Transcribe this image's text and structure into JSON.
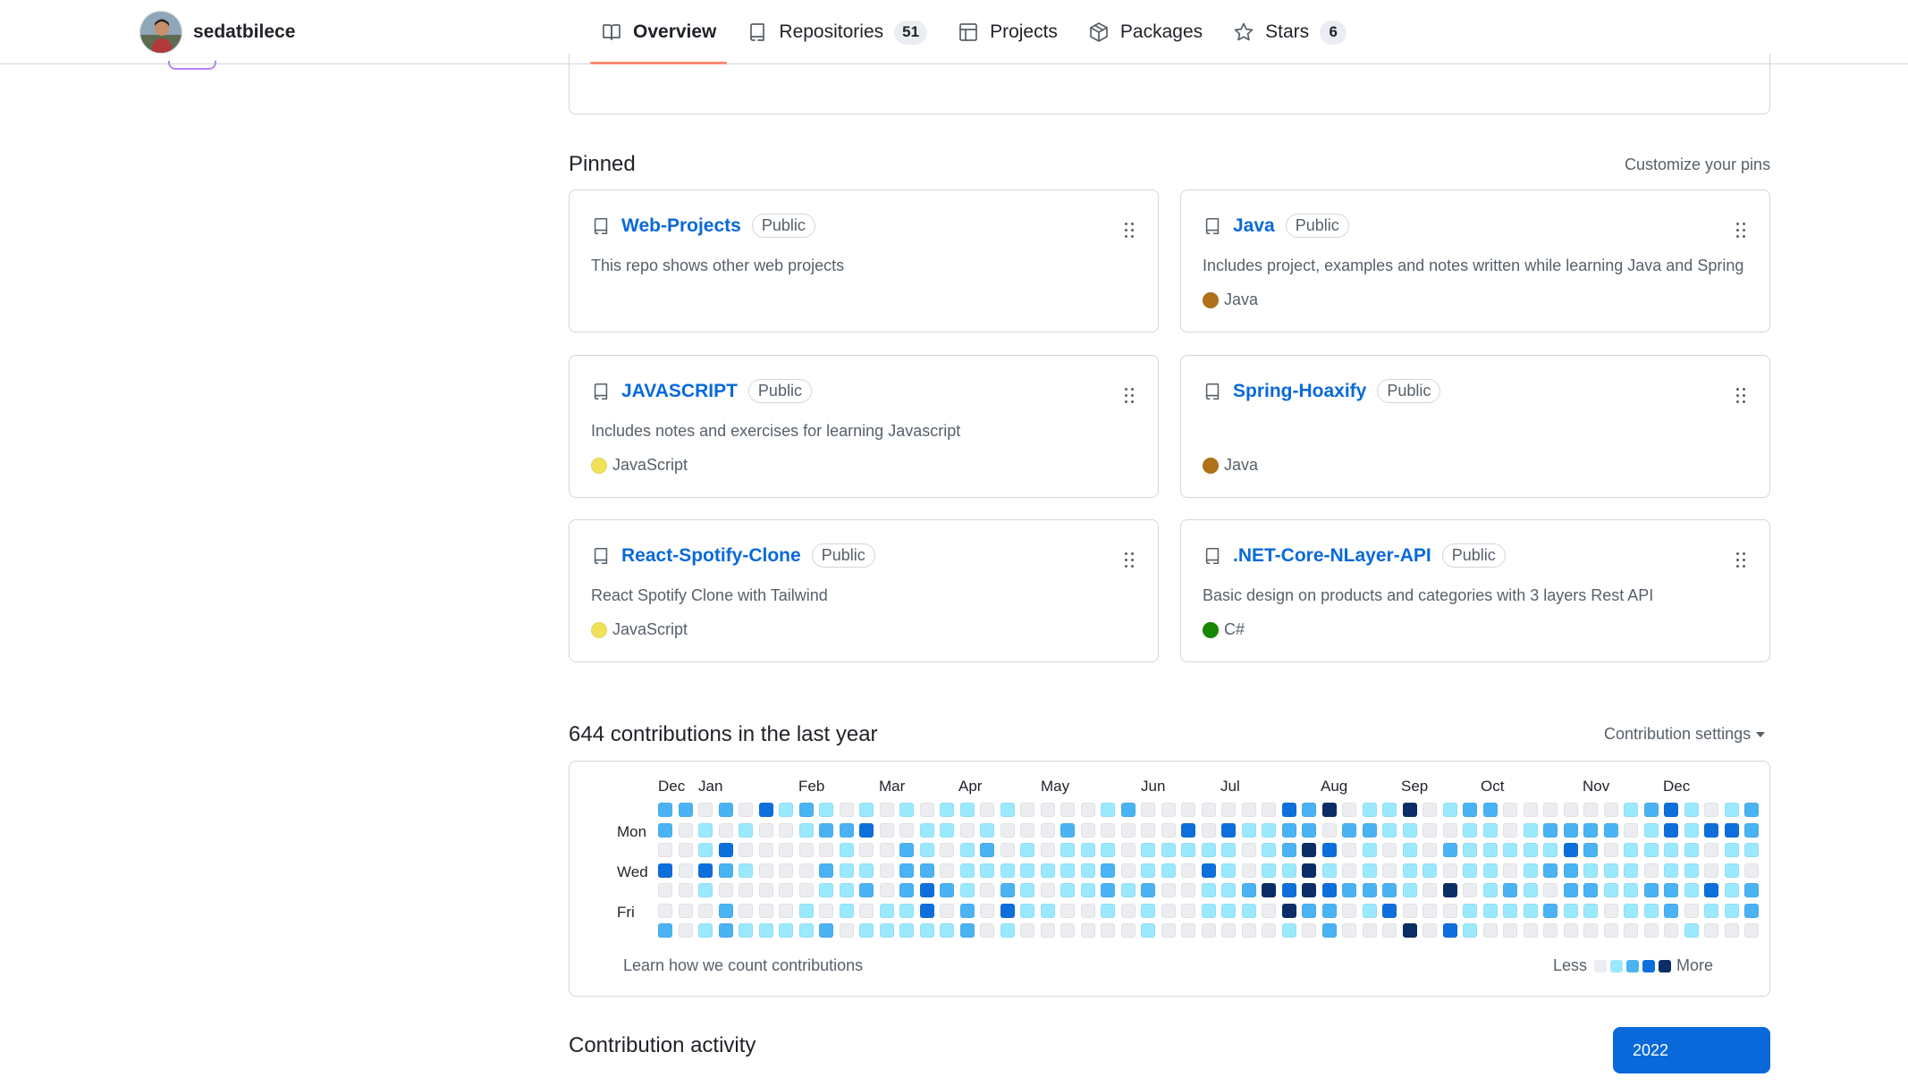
{
  "user": {
    "username": "sedatbilece"
  },
  "tabs": [
    {
      "label": "Overview",
      "count": null
    },
    {
      "label": "Repositories",
      "count": "51"
    },
    {
      "label": "Projects",
      "count": null
    },
    {
      "label": "Packages",
      "count": null
    },
    {
      "label": "Stars",
      "count": "6"
    }
  ],
  "pinned": {
    "title": "Pinned",
    "customize_label": "Customize your pins",
    "repos": [
      {
        "name": "Web-Projects",
        "visibility": "Public",
        "description": "This repo shows other web projects",
        "language": "",
        "language_color": ""
      },
      {
        "name": "Java",
        "visibility": "Public",
        "description": "Includes project, examples and notes written while learning Java and Spring",
        "language": "Java",
        "language_color": "#b07219"
      },
      {
        "name": "JAVASCRIPT",
        "visibility": "Public",
        "description": "Includes notes and exercises for learning Javascript",
        "language": "JavaScript",
        "language_color": "#f1e05a"
      },
      {
        "name": "Spring-Hoaxify",
        "visibility": "Public",
        "description": "",
        "language": "Java",
        "language_color": "#b07219"
      },
      {
        "name": "React-Spotify-Clone",
        "visibility": "Public",
        "description": "React Spotify Clone with Tailwind",
        "language": "JavaScript",
        "language_color": "#f1e05a"
      },
      {
        "name": ".NET-Core-NLayer-API",
        "visibility": "Public",
        "description": "Basic design on products and categories with 3 layers Rest API",
        "language": "C#",
        "language_color": "#178600"
      }
    ]
  },
  "contributions": {
    "heading": "644 contributions in the last year",
    "settings_label": "Contribution settings",
    "months": [
      "Dec",
      "Jan",
      "Feb",
      "Mar",
      "Apr",
      "May",
      "Jun",
      "Jul",
      "Aug",
      "Sep",
      "Oct",
      "Nov",
      "Dec"
    ],
    "day_labels": [
      "Mon",
      "Wed",
      "Fri"
    ],
    "learn_label": "Learn how we count contributions",
    "legend_less": "Less",
    "legend_more": "More",
    "level_colors": [
      "#ebedf0",
      "#9be9ff",
      "#4ab3f4",
      "#0d6fdc",
      "#0b2e66"
    ],
    "weeks": [
      [
        2,
        2,
        0,
        3,
        0,
        0,
        2
      ],
      [
        2,
        0,
        0,
        0,
        0,
        0,
        0
      ],
      [
        0,
        1,
        1,
        3,
        1,
        0,
        1
      ],
      [
        2,
        0,
        3,
        2,
        0,
        2,
        2
      ],
      [
        0,
        1,
        0,
        1,
        0,
        0,
        1
      ],
      [
        3,
        0,
        0,
        0,
        0,
        0,
        1
      ],
      [
        1,
        0,
        0,
        0,
        0,
        0,
        1
      ],
      [
        2,
        1,
        0,
        0,
        0,
        1,
        1
      ],
      [
        1,
        2,
        0,
        2,
        1,
        0,
        2
      ],
      [
        0,
        2,
        1,
        1,
        1,
        1,
        0
      ],
      [
        1,
        3,
        0,
        1,
        2,
        0,
        1
      ],
      [
        0,
        0,
        0,
        0,
        0,
        1,
        1
      ],
      [
        1,
        0,
        2,
        2,
        2,
        1,
        1
      ],
      [
        0,
        1,
        1,
        2,
        3,
        3,
        1
      ],
      [
        1,
        1,
        0,
        0,
        2,
        0,
        1
      ],
      [
        1,
        0,
        1,
        1,
        1,
        2,
        2
      ],
      [
        0,
        1,
        2,
        1,
        0,
        0,
        0
      ],
      [
        1,
        0,
        0,
        1,
        2,
        3,
        1
      ],
      [
        0,
        0,
        1,
        1,
        1,
        1,
        0
      ],
      [
        0,
        0,
        0,
        1,
        0,
        1,
        0
      ],
      [
        0,
        2,
        1,
        1,
        1,
        0,
        0
      ],
      [
        0,
        0,
        1,
        1,
        1,
        0,
        0
      ],
      [
        1,
        0,
        1,
        2,
        2,
        1,
        0
      ],
      [
        2,
        0,
        0,
        0,
        1,
        0,
        0
      ],
      [
        0,
        0,
        1,
        1,
        2,
        1,
        1
      ],
      [
        0,
        0,
        1,
        1,
        0,
        0,
        0
      ],
      [
        0,
        3,
        1,
        0,
        0,
        0,
        0
      ],
      [
        0,
        0,
        1,
        3,
        1,
        1,
        0
      ],
      [
        0,
        3,
        1,
        1,
        1,
        1,
        0
      ],
      [
        0,
        1,
        0,
        0,
        2,
        1,
        0
      ],
      [
        0,
        1,
        1,
        1,
        4,
        0,
        0
      ],
      [
        3,
        2,
        2,
        1,
        3,
        4,
        1
      ],
      [
        2,
        2,
        4,
        4,
        4,
        2,
        0
      ],
      [
        4,
        0,
        3,
        1,
        3,
        2,
        2
      ],
      [
        0,
        2,
        0,
        0,
        2,
        0,
        0
      ],
      [
        1,
        2,
        1,
        1,
        2,
        1,
        0
      ],
      [
        1,
        1,
        0,
        0,
        2,
        3,
        0
      ],
      [
        4,
        1,
        1,
        1,
        1,
        0,
        4
      ],
      [
        0,
        0,
        0,
        1,
        0,
        0,
        0
      ],
      [
        1,
        0,
        2,
        0,
        4,
        0,
        3
      ],
      [
        2,
        1,
        1,
        1,
        0,
        1,
        1
      ],
      [
        2,
        1,
        1,
        1,
        1,
        1,
        0
      ],
      [
        0,
        0,
        1,
        0,
        2,
        1,
        0
      ],
      [
        0,
        1,
        1,
        1,
        1,
        1,
        0
      ],
      [
        0,
        2,
        1,
        2,
        0,
        2,
        0
      ],
      [
        0,
        2,
        3,
        2,
        2,
        1,
        0
      ],
      [
        0,
        2,
        2,
        1,
        2,
        1,
        0
      ],
      [
        0,
        2,
        0,
        1,
        1,
        0,
        0
      ],
      [
        1,
        0,
        1,
        1,
        1,
        1,
        0
      ],
      [
        2,
        1,
        1,
        0,
        2,
        1,
        0
      ],
      [
        3,
        3,
        1,
        1,
        2,
        2,
        0
      ],
      [
        1,
        1,
        1,
        1,
        1,
        0,
        1
      ],
      [
        0,
        3,
        0,
        0,
        3,
        1,
        0
      ],
      [
        1,
        3,
        1,
        1,
        1,
        1,
        0
      ],
      [
        2,
        2,
        1,
        0,
        2,
        2,
        0
      ]
    ]
  },
  "activity": {
    "title": "Contribution activity",
    "year": "2022"
  }
}
